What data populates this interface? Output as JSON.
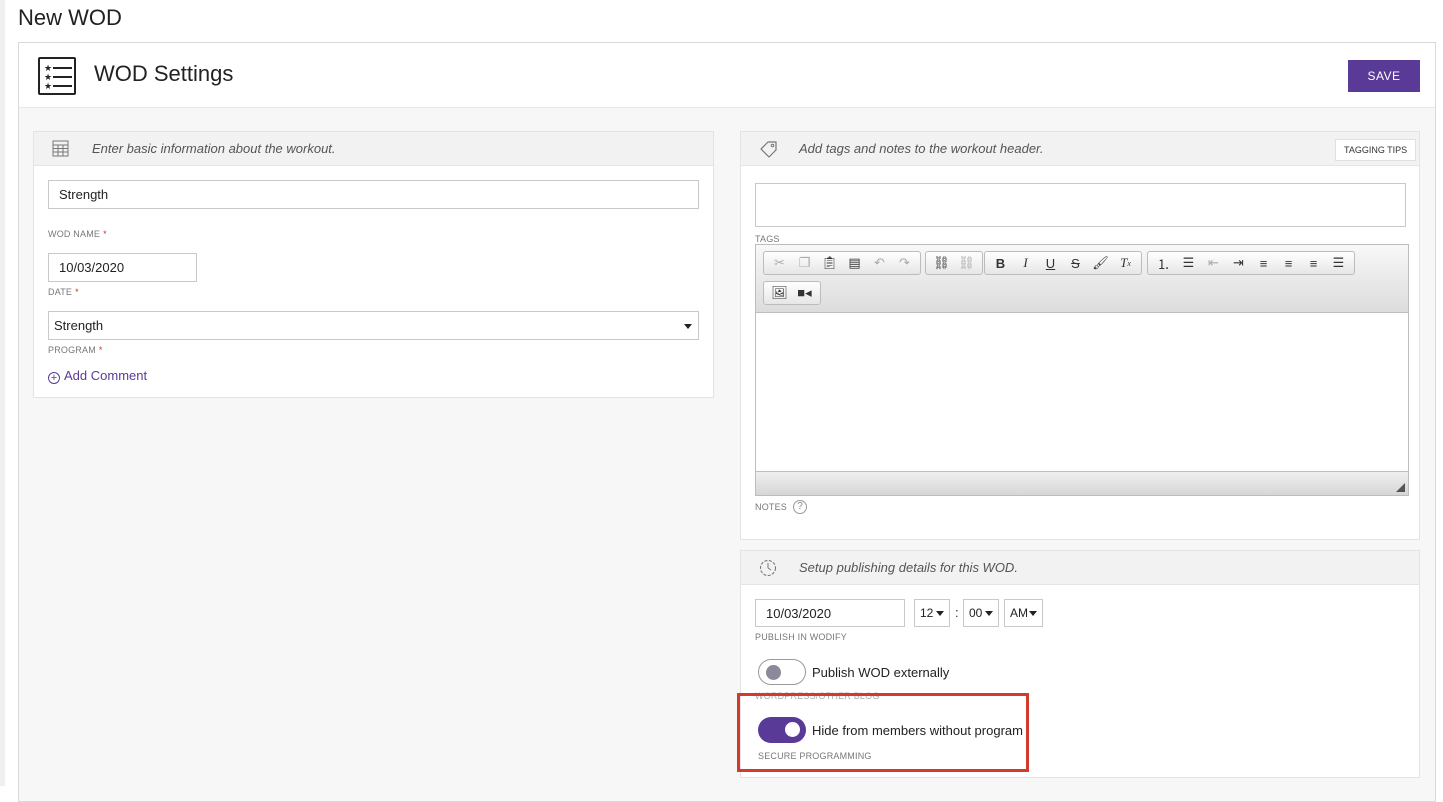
{
  "page": {
    "title": "New WOD"
  },
  "card": {
    "title": "WOD Settings",
    "save_label": "SAVE"
  },
  "basic": {
    "hint": "Enter basic information about the workout.",
    "wod_name_value": "Strength",
    "wod_name_label": "WOD NAME",
    "date_value": "10/03/2020",
    "date_label": "DATE",
    "program_value": "Strength",
    "program_label": "PROGRAM",
    "required_mark": "*",
    "add_comment": "Add Comment"
  },
  "tags": {
    "hint": "Add  tags  and notes to the workout header.",
    "tagging_tips": "TAGGING TIPS",
    "tags_value": "",
    "tags_label": "TAGS",
    "notes_label": "NOTES",
    "help_glyph": "?"
  },
  "toolbar": {
    "groups": [
      [
        "cut-icon",
        "copy-icon",
        "paste-icon",
        "paste-text-icon",
        "undo-icon",
        "redo-icon"
      ],
      [
        "link-icon",
        "unlink-icon"
      ],
      [
        "bold-icon",
        "italic-icon",
        "underline-icon",
        "strikethrough-icon",
        "paintbrush-icon",
        "clear-format-icon"
      ],
      [
        "numbered-list-icon",
        "bulleted-list-icon",
        "outdent-icon",
        "indent-icon",
        "align-left-icon",
        "align-center-icon",
        "align-right-icon",
        "align-justify-icon"
      ],
      [
        "image-icon",
        "video-icon"
      ]
    ]
  },
  "publish": {
    "hint": "Setup publishing details for this WOD.",
    "date_value": "10/03/2020",
    "hour": "12",
    "separator": ":",
    "minute": "00",
    "ampm": "AM",
    "publish_label": "PUBLISH IN WODIFY",
    "external_label": "Publish WOD externally",
    "external_on": false,
    "external_sub": "WORDPRESS/OTHER BLOG",
    "hide_label": "Hide from members without program",
    "hide_on": true,
    "hide_sub": "SECURE PROGRAMMING"
  },
  "colors": {
    "accent": "#5a3a97",
    "highlight": "#d23b2b",
    "required": "#c0392b"
  }
}
